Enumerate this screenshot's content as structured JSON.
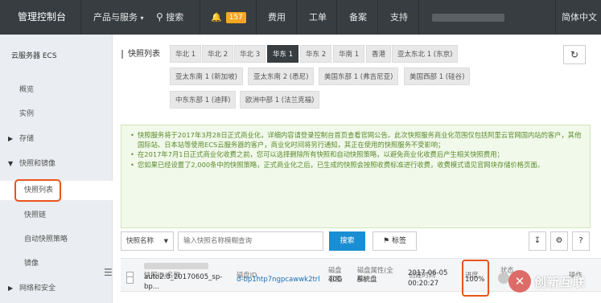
{
  "topbar": {
    "brand": "管理控制台",
    "products": "产品与服务",
    "search": "搜索",
    "notifications_count": "157",
    "items": [
      "费用",
      "工单",
      "备案",
      "支持"
    ],
    "language": "简体中文"
  },
  "sidebar": {
    "title": "云服务器 ECS",
    "items": [
      {
        "label": "概览"
      },
      {
        "label": "实例"
      },
      {
        "label": "存储"
      },
      {
        "label": "快照和镜像"
      },
      {
        "label": "快照列表"
      },
      {
        "label": "快照链"
      },
      {
        "label": "自动快照策略"
      },
      {
        "label": "镜像"
      },
      {
        "label": "网络和安全"
      }
    ]
  },
  "main": {
    "title": "快照列表",
    "regions": [
      "华北 1",
      "华北 2",
      "华北 3",
      "华东 1",
      "华东 2",
      "华南 1",
      "香港",
      "亚太东北 1 (东京)",
      "亚太东南 1 (新加坡)",
      "亚太东南 2 (悉尼)",
      "美国东部 1 (弗吉尼亚)",
      "美国西部 1 (硅谷)",
      "中东东部 1 (迪拜)",
      "欧洲中部 1 (法兰克福)"
    ],
    "active_region": "华东 1",
    "notice": [
      "快照服务将于2017年3月28日正式商业化，详细内容请登录控制台首页查看官网公告。此次快照服务商业化范围仅包括阿里云官网国内站的客户，其他国际站、日本站等使用ECS云服务器的客户，商业化时间将另行通知，其正在使用的快照服务不受影响；",
      "在2017年7月1日正式商业化收费之前，您可以选择删除所有快照和自动快照策略，以避免商业化收费后产生相关快照费用；",
      "您如果已经设置了2,000条中的快照策略，正式商业化之后，已生成的快照会按照收费标准进行收费，收费模式请见官网块存储价格页面。"
    ],
    "search": {
      "select_label": "快照名称",
      "placeholder": "输入快照名称模糊查询",
      "search_button": "搜索",
      "tag_button": "标签"
    },
    "table": {
      "headers": {
        "name": "快照ID/名称",
        "disk_id": "磁盘ID",
        "disk_size": "磁盘容量",
        "disk_attr": "磁盘属性(全部)",
        "created": "创建时间",
        "progress": "进度",
        "status": "状态",
        "actions": "操作"
      },
      "rows": [
        {
          "name_line1": "auto2.0_20170605_sp-",
          "name_line2": "bp...",
          "disk_id": "d-bp1htp7ngpcawwk2trl",
          "disk_size": "40G",
          "disk_attr": "系统盘",
          "created_date": "2017-06-05",
          "created_time": "00:20:27",
          "progress": "100%"
        }
      ]
    }
  },
  "watermark": {
    "text": "创新互联"
  }
}
